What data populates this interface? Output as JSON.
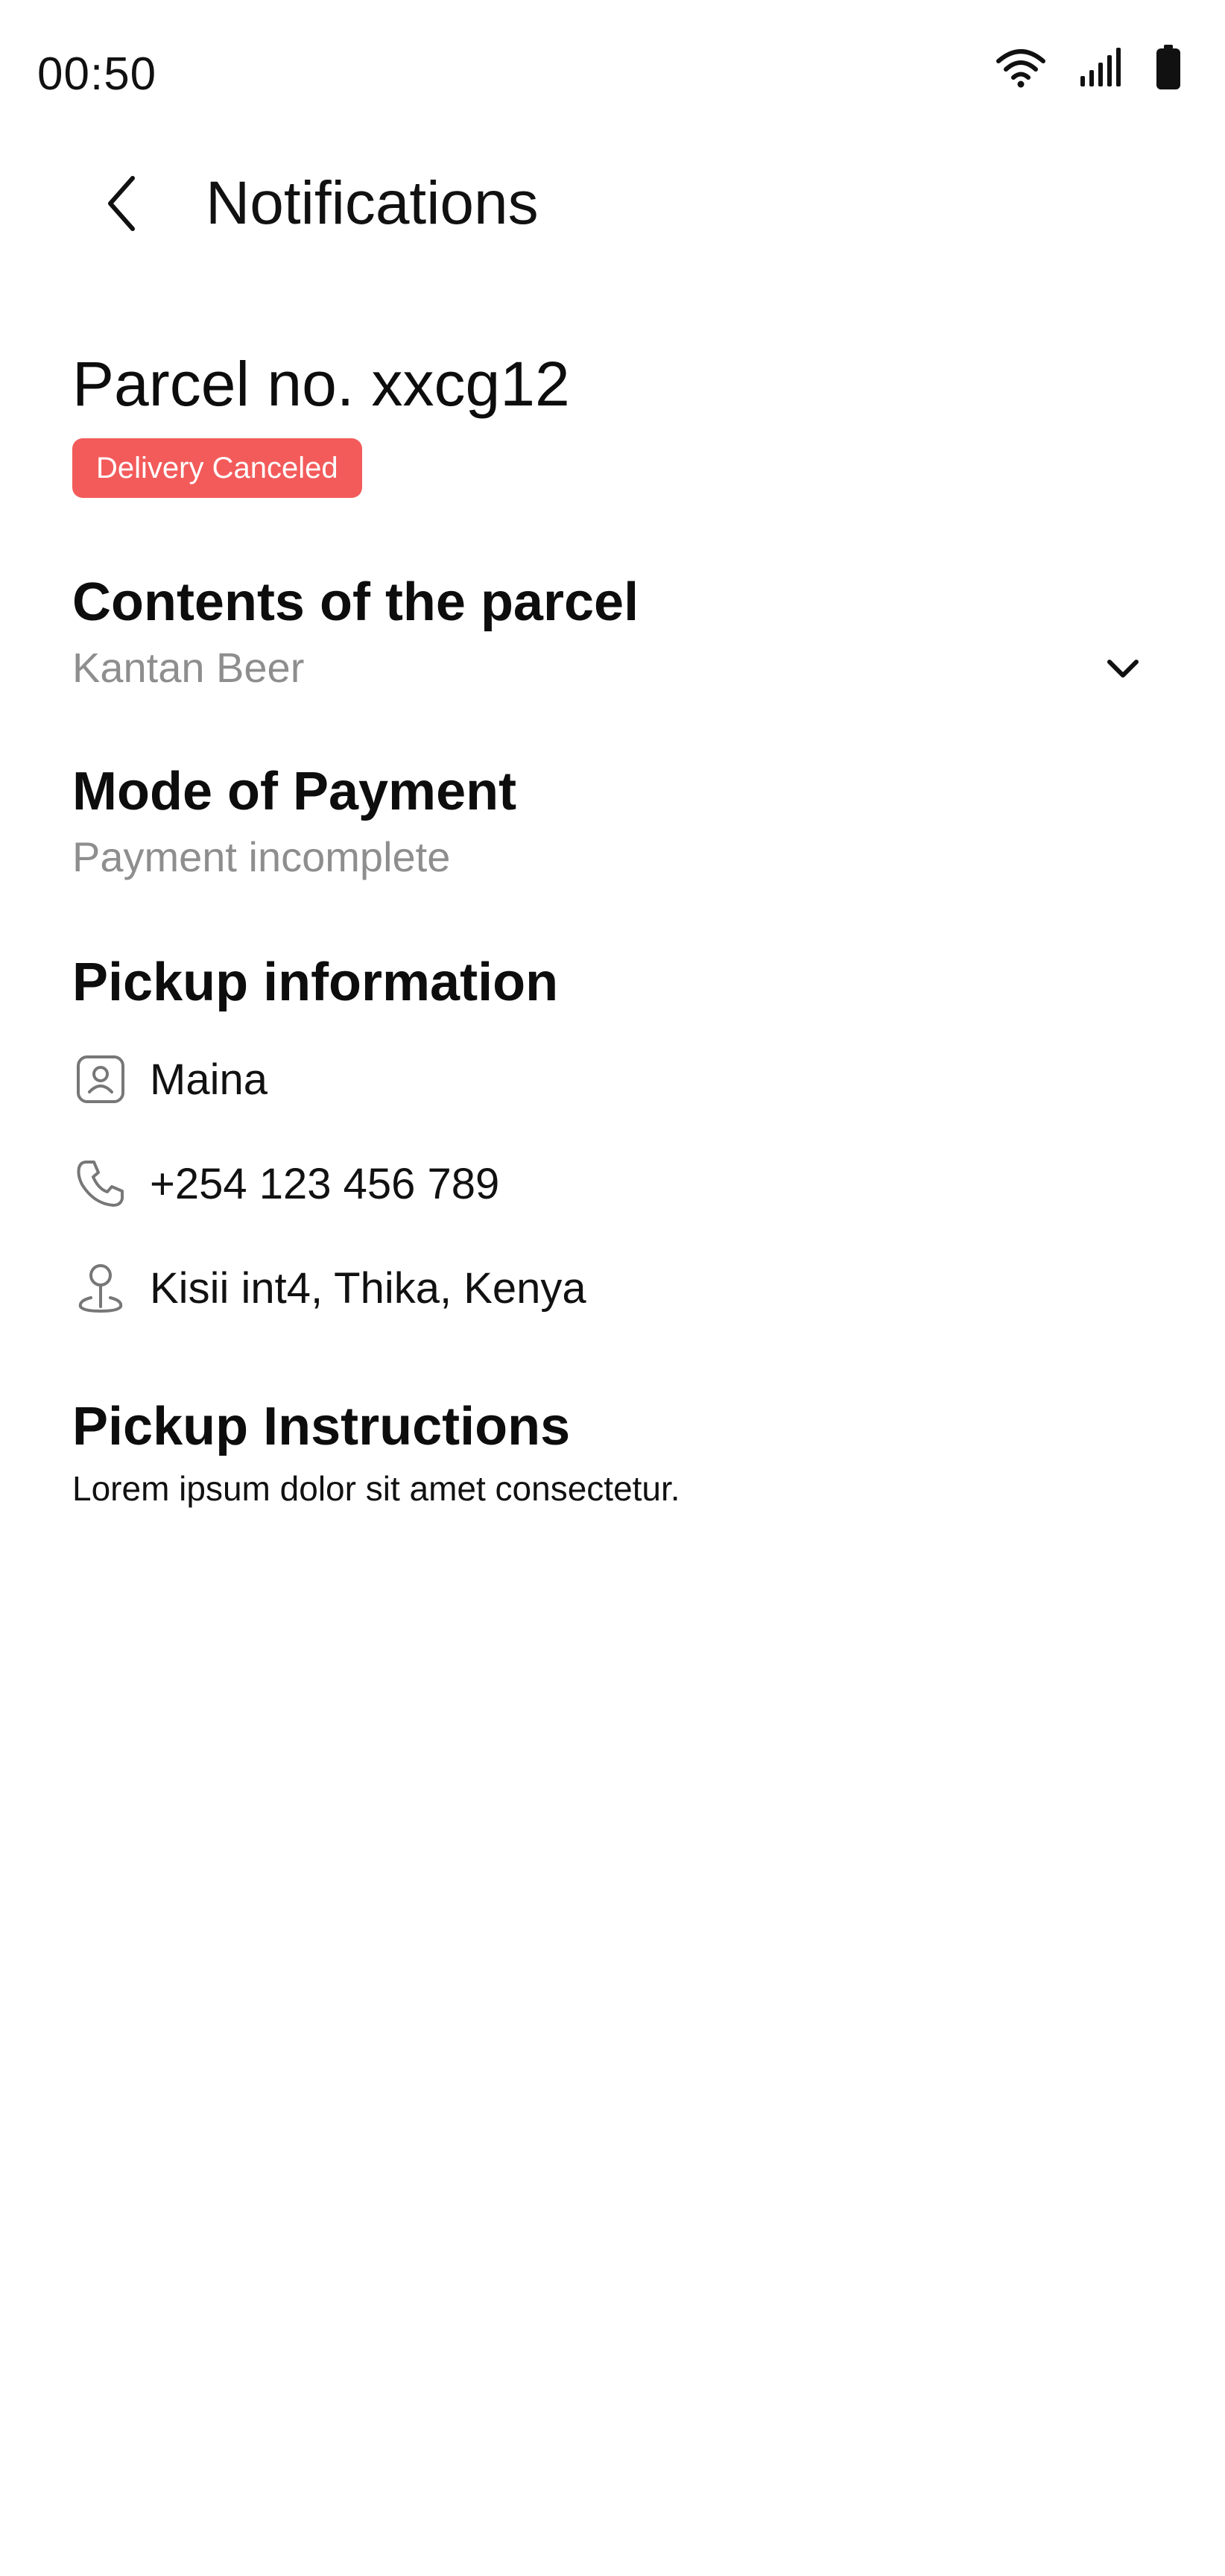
{
  "status_bar": {
    "time": "00:50",
    "icons": [
      "wifi-icon",
      "signal-icon",
      "battery-icon"
    ]
  },
  "header": {
    "title": "Notifications",
    "back_icon": "chevron-left-icon"
  },
  "parcel": {
    "title": "Parcel no. xxcg12",
    "status_badge": "Delivery Canceled",
    "status_color": "#f35b5b"
  },
  "contents": {
    "title": "Contents of the parcel",
    "value": "Kantan Beer",
    "toggle_icon": "chevron-down-icon"
  },
  "payment": {
    "title": "Mode of Payment",
    "value": "Payment incomplete"
  },
  "pickup": {
    "title": "Pickup information",
    "name": "Maina",
    "phone": "+254 123 456 789",
    "location": "Kisii int4, Thika, Kenya",
    "name_icon": "user-icon",
    "phone_icon": "phone-icon",
    "location_icon": "location-pin-icon"
  },
  "instructions": {
    "title": "Pickup Instructions",
    "text": "Lorem ipsum dolor sit amet consectetur."
  }
}
